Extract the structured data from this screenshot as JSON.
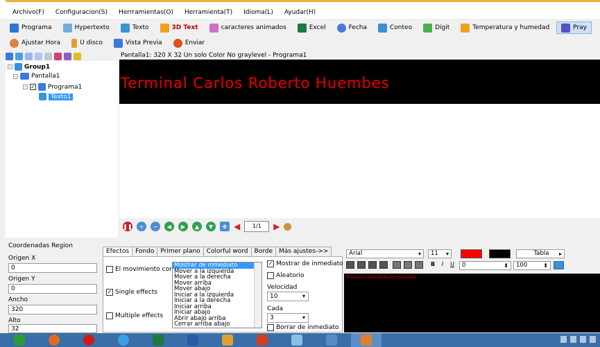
{
  "menu": [
    "Archivo(F)",
    "Configuracion(S)",
    "Herrramientas(O)",
    "Herramienta(T)",
    "Idioma(L)",
    "Ayudar(H)"
  ],
  "toolbar1": [
    {
      "label": "Programa",
      "icon": "program-icon",
      "color": "#2e74d2"
    },
    {
      "label": "Hypertexto",
      "icon": "hypertext-icon",
      "color": "#6fb0d8"
    },
    {
      "label": "Texto",
      "icon": "text-icon",
      "color": "#3a94d8"
    },
    {
      "label": "3D Text",
      "icon": "3d-text-icon",
      "color": "#f0a020",
      "label_color": "#c00000"
    },
    {
      "label": "caracteres animados",
      "icon": "animated-chars-icon",
      "color": "#d070c8"
    },
    {
      "label": "Excel",
      "icon": "excel-icon",
      "color": "#1e7a3c"
    },
    {
      "label": "Fecha",
      "icon": "date-icon",
      "color": "#4a78d8"
    },
    {
      "label": "Conteo",
      "icon": "counter-icon",
      "color": "#3a8fd8"
    },
    {
      "label": "Digit",
      "icon": "digit-icon",
      "color": "#4caf50"
    },
    {
      "label": "Temperatura y humedad",
      "icon": "temperature-icon",
      "color": "#f0a020"
    },
    {
      "label": "Pray",
      "icon": "pray-icon",
      "color": "#5050c8"
    }
  ],
  "toolbar2": [
    {
      "label": "Ajustar Hora",
      "icon": "clock-icon",
      "color": "#e08040"
    },
    {
      "label": "U disco",
      "icon": "usb-disk-icon",
      "color": "#e0a030"
    },
    {
      "label": "Vista Previa",
      "icon": "preview-icon",
      "color": "#3a7ad8"
    },
    {
      "label": "Enviar",
      "icon": "send-icon",
      "color": "#e05020"
    }
  ],
  "tree": {
    "group": "Group1",
    "screen": "Pantalla1",
    "program": "Programa1",
    "text": "Texto1"
  },
  "screen_header": "Pantalla1: 320 X 32  Un solo Color No graylevel - Programa1",
  "led_text": "Terminal Carlos Roberto Huembes",
  "page_indicator": "1/1",
  "coords": {
    "title": "Coordenadas Region",
    "origin_x_label": "Origen X",
    "origin_x": "0",
    "origin_y_label": "Origen Y",
    "origin_y": "0",
    "width_label": "Ancho",
    "width": "320",
    "height_label": "Alto",
    "height": "32"
  },
  "effects_tabs": [
    "Efectos",
    "Fondo",
    "Primer plano",
    "Colorful word",
    "Borde",
    "Más ajustes->>"
  ],
  "effects": {
    "move_cont": "El movimiento cont",
    "single": "Single effects",
    "multiple": "Multiple effects",
    "list": [
      "Mostrar de inmediato",
      "Mover a la izquierda",
      "Mover a la derecha",
      "Mover arriba",
      "Mover abajo",
      "Iniciar a la izquierda",
      "Iniciar a la derecha",
      "Iniciar arriba",
      "Iniciar abajo",
      "Abrir abajo arriba",
      "Cerrar arriba abajo"
    ],
    "show_immediate": "Mostrar de inmediato",
    "random": "Aleatorio",
    "speed_label": "Velocidad",
    "speed": "10",
    "each_label": "Cada",
    "each": "3",
    "clear_immediate": "Borrar de inmediato"
  },
  "format": {
    "font": "Arial",
    "size": "11",
    "fg_color": "#ff0000",
    "bg_color": "#000000",
    "table_label": "Tabla",
    "spacing1": "0",
    "spacing2": "100"
  },
  "preview_text": "Terminal Carlos Roberto Huembes"
}
